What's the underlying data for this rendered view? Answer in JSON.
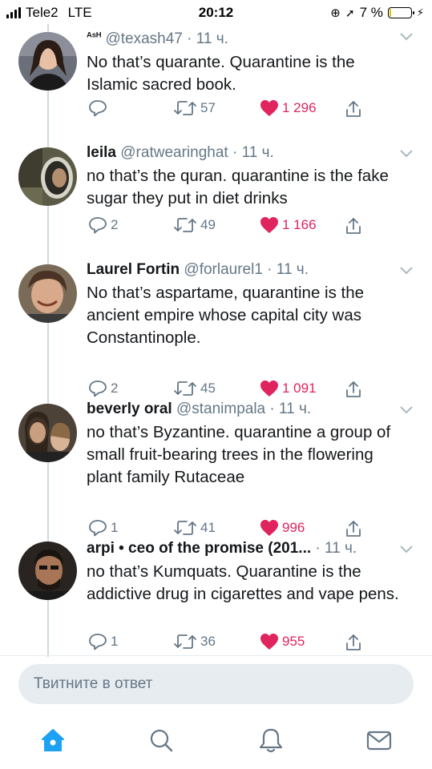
{
  "status": {
    "carrier": "Tele2",
    "network": "LTE",
    "time": "20:12",
    "battery": "7 %"
  },
  "tweets": [
    {
      "name": "ᴬˢᴴ",
      "handle": "@texash47",
      "time": "· 11 ч.",
      "text": "No that’s quarante. Quarantine is the Islamic sacred book.",
      "replies": "",
      "retweets": "57",
      "likes": "1 296"
    },
    {
      "name": "leila",
      "handle": "@ratwearinghat",
      "time": "· 11 ч.",
      "text": "no that’s the quran. quarantine is the fake sugar they put in diet drinks",
      "replies": "2",
      "retweets": "49",
      "likes": "1 166"
    },
    {
      "name": "Laurel Fortin",
      "handle": "@forlaurel1",
      "time": "· 11 ч.",
      "text": "No that’s aspartame, quarantine is the ancient empire whose capital city was Constantinople.",
      "replies": "2",
      "retweets": "45",
      "likes": "1 091"
    },
    {
      "name": "beverly oral",
      "handle": "@stanimpala",
      "time": "· 11 ч.",
      "text": "no that’s Byzantine. quarantine a group of small fruit-bearing trees in the flowering plant family Rutaceae",
      "replies": "1",
      "retweets": "41",
      "likes": "996"
    },
    {
      "name": "arpi • ceo of the promise (201...",
      "handle": "",
      "time": "· 11 ч.",
      "text": "no that’s Kumquats. Quarantine is the addictive drug in cigarettes and vape pens.",
      "replies": "1",
      "retweets": "36",
      "likes": "955"
    }
  ],
  "reply_placeholder": "Твитните в ответ",
  "tabs": [
    "home-icon",
    "search-icon",
    "notifications-icon",
    "messages-icon"
  ],
  "colors": {
    "accent": "#1da1f2",
    "like": "#e0245e",
    "muted": "#657786",
    "text": "#14171a"
  }
}
